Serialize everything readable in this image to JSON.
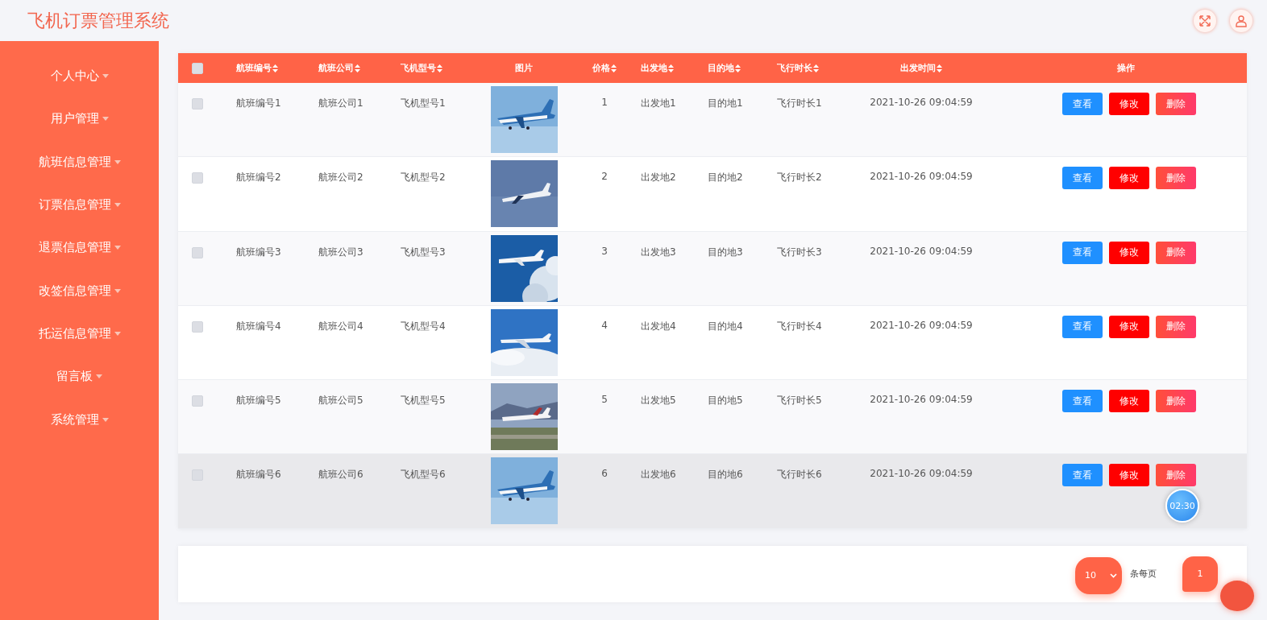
{
  "header": {
    "title": "飞机订票管理系统"
  },
  "sidebar": {
    "items": [
      {
        "label": "个人中心",
        "expanded": false
      },
      {
        "label": "用户管理",
        "expanded": false
      },
      {
        "label": "航班信息管理",
        "expanded": false
      },
      {
        "label": "订票信息管理",
        "expanded": false
      },
      {
        "label": "退票信息管理",
        "expanded": false
      },
      {
        "label": "改签信息管理",
        "expanded": false
      },
      {
        "label": "托运信息管理",
        "expanded": false
      },
      {
        "label": "留言板",
        "expanded": false
      },
      {
        "label": "系统管理",
        "expanded": false
      }
    ]
  },
  "table": {
    "select_all": {
      "checked": false
    },
    "columns": [
      {
        "label": "航班编号",
        "sortable": true,
        "kind": "text"
      },
      {
        "label": "航班公司",
        "sortable": true,
        "kind": "text"
      },
      {
        "label": "飞机型号",
        "sortable": true,
        "kind": "text"
      },
      {
        "label": "图片",
        "sortable": false
      },
      {
        "label": "价格",
        "sortable": true,
        "kind": "num"
      },
      {
        "label": "出发地",
        "sortable": true,
        "kind": "text"
      },
      {
        "label": "目的地",
        "sortable": true,
        "kind": "text"
      },
      {
        "label": "飞行时长",
        "sortable": true,
        "kind": "text"
      },
      {
        "label": "出发时间",
        "sortable": true,
        "kind": "time"
      },
      {
        "label": "操作",
        "sortable": false,
        "kind": "actions"
      }
    ],
    "rows": [
      {
        "checked": false,
        "hovered": false,
        "cells": [
          "航班编号1",
          "航班公司1",
          "飞机型号1",
          null,
          "1",
          "出发地1",
          "目的地1",
          "飞行时长1",
          "2021-10-26 09:04:59"
        ],
        "actions": [
          "查看",
          "修改",
          "删除"
        ]
      },
      {
        "checked": false,
        "hovered": false,
        "cells": [
          "航班编号2",
          "航班公司2",
          "飞机型号2",
          null,
          "2",
          "出发地2",
          "目的地2",
          "飞行时长2",
          "2021-10-26 09:04:59"
        ],
        "actions": [
          "查看",
          "修改",
          "删除"
        ]
      },
      {
        "checked": false,
        "hovered": false,
        "cells": [
          "航班编号3",
          "航班公司3",
          "飞机型号3",
          null,
          "3",
          "出发地3",
          "目的地3",
          "飞行时长3",
          "2021-10-26 09:04:59"
        ],
        "actions": [
          "查看",
          "修改",
          "删除"
        ]
      },
      {
        "checked": false,
        "hovered": false,
        "cells": [
          "航班编号4",
          "航班公司4",
          "飞机型号4",
          null,
          "4",
          "出发地4",
          "目的地4",
          "飞行时长4",
          "2021-10-26 09:04:59"
        ],
        "actions": [
          "查看",
          "修改",
          "删除"
        ]
      },
      {
        "checked": false,
        "hovered": false,
        "cells": [
          "航班编号5",
          "航班公司5",
          "飞机型号5",
          null,
          "5",
          "出发地5",
          "目的地5",
          "飞行时长5",
          "2021-10-26 09:04:59"
        ],
        "actions": [
          "查看",
          "修改",
          "删除"
        ]
      },
      {
        "checked": false,
        "hovered": true,
        "cells": [
          "航班编号6",
          "航班公司6",
          "飞机型号6",
          null,
          "6",
          "出发地6",
          "目的地6",
          "飞行时长6",
          "2021-10-26 09:04:59"
        ],
        "actions": [
          "查看",
          "修改",
          "删除"
        ]
      }
    ]
  },
  "timer": {
    "text": "02:30"
  },
  "pagination": {
    "page_size": "10",
    "page_size_label": "条每页",
    "current_page": "1"
  }
}
